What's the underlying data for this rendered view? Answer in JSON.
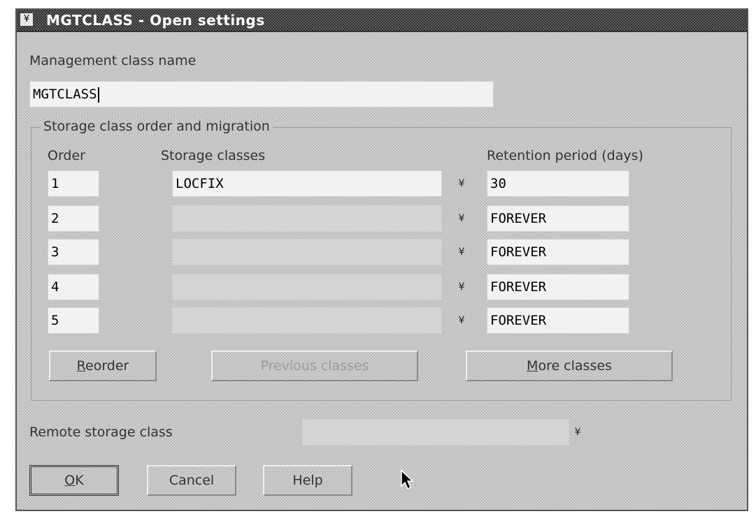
{
  "window": {
    "title": "MGTCLASS - Open settings",
    "sysmenu_glyph": "¥"
  },
  "management_class": {
    "label": "Management class name",
    "value": "MGTCLASS"
  },
  "storage_group": {
    "title": "Storage class order and migration",
    "headers": {
      "order": "Order",
      "storage_classes": "Storage classes",
      "retention": "Retention period (days)"
    },
    "rows": [
      {
        "order": "1",
        "storage_class": "LOCFIX",
        "retention": "30"
      },
      {
        "order": "2",
        "storage_class": "",
        "retention": "FOREVER"
      },
      {
        "order": "3",
        "storage_class": "",
        "retention": "FOREVER"
      },
      {
        "order": "4",
        "storage_class": "",
        "retention": "FOREVER"
      },
      {
        "order": "5",
        "storage_class": "",
        "retention": "FOREVER"
      }
    ],
    "dropdown_glyph": "¥",
    "buttons": {
      "reorder_mnemonic": "R",
      "reorder_rest": "eorder",
      "previous_classes": "Previous classes",
      "more_mnemonic": "M",
      "more_rest": "ore classes"
    }
  },
  "remote": {
    "label": "Remote storage class",
    "value": ""
  },
  "footer": {
    "ok_mnemonic": "O",
    "ok_rest": "K",
    "cancel": "Cancel",
    "help": "Help"
  }
}
